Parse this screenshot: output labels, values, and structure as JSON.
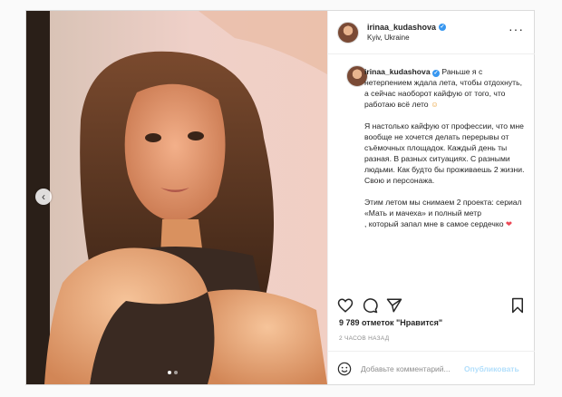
{
  "post": {
    "username": "irinaa_kudashova",
    "location": "Kyiv, Ukraine",
    "verified_icon": "verified-badge-icon",
    "more_icon": "more-options-icon",
    "caption": {
      "p1": "Раньше я с нетерпением ждала лета, чтобы отдохнуть, а сейчас наоборот кайфую от того, что работаю всё лето",
      "p2": "Я настолько кайфую от профессии, что мне вообще не хочется делать перерывы от съёмочных площадок. Каждый день ты разная. В разных ситуациях. С разными людьми. Как будто бы проживаешь 2 жизни. Свою и персонажа.",
      "p3": "Этим летом мы снимаем 2 проекта: сериал «Мать и мачеха» и полный метр",
      "p4": ", который запал мне в самое сердечко"
    },
    "likes": "9 789 отметок \"Нравится\"",
    "time_ago": "2 ЧАСОВ НАЗАД",
    "comment_placeholder": "Добавьте комментарий...",
    "post_button": "Опубликовать",
    "carousel_dots": 2,
    "carousel_active": 1
  },
  "colors": {
    "accent": "#3897f0",
    "like_heart": "#ed4956",
    "post_disabled": "#b2dffc"
  }
}
